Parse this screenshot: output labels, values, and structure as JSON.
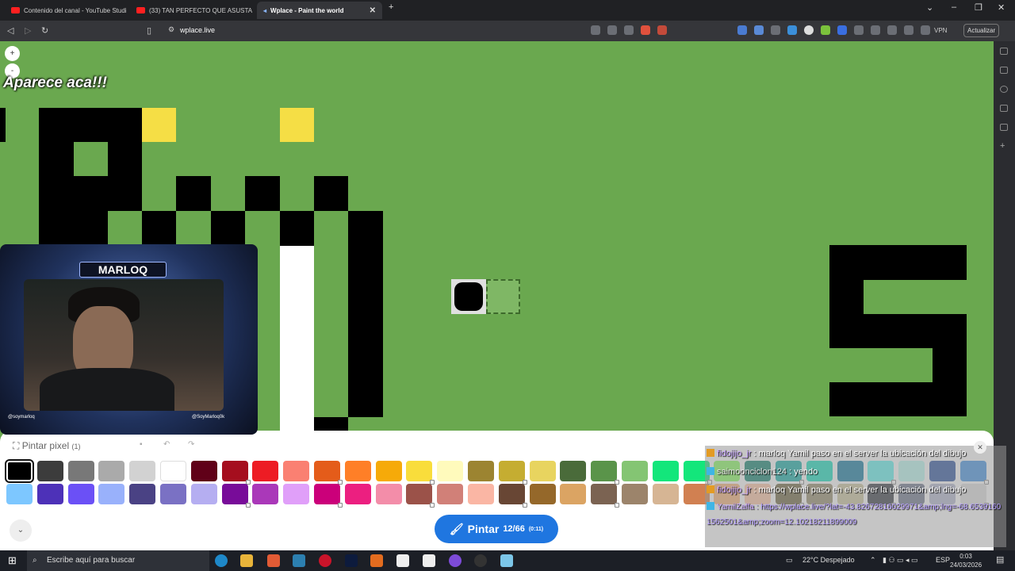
{
  "browser": {
    "tabs": [
      {
        "label": "Contenido del canal - YouTube Studi"
      },
      {
        "label": "(33) TAN PERFECTO QUE ASUSTA"
      },
      {
        "label": "Wplace - Paint the world"
      }
    ],
    "url": "wplace.live",
    "vpn": "VPN",
    "update_label": "Actualizar"
  },
  "canvas": {
    "overlay_text": "Aparece aca!!!",
    "zoom_in": "+",
    "zoom_out": "-"
  },
  "webcam": {
    "name": "MARLOQ",
    "instagram": "@soymarloq",
    "twitter": "@SoyMarloq0k"
  },
  "panel": {
    "title": "Pintar pixel",
    "count": "(1)",
    "paint_label": "Pintar",
    "charges": "12/66",
    "timer": "(0:11)"
  },
  "palette": {
    "row1": [
      "#000000",
      "#3c3c3c",
      "#787878",
      "#aaaaaa",
      "#d2d2d2",
      "#ffffff",
      "#600018",
      "#a50e1e",
      "#ed1c24",
      "#fa8072",
      "#e45c1a",
      "#ff7f27",
      "#f6aa09",
      "#f9dd3b",
      "#fffabc",
      "#9c8431",
      "#c5ad31",
      "#e8d45f",
      "#4a6b3a",
      "#5a944a",
      "#84c573",
      "#13e67b",
      "#13e67b",
      "#87ff5e",
      "#0c816e",
      "#10aea6",
      "#13e1be",
      "#0f799f",
      "#60f7f2",
      "#bbfaf2",
      "#28509e",
      "#4093e4"
    ],
    "row2": [
      "#7dc7ff",
      "#4d31b8",
      "#6b50f6",
      "#99b1fb",
      "#4a4284",
      "#7a71c4",
      "#b5aef1",
      "#780c99",
      "#aa38b9",
      "#e09ff9",
      "#cb007a",
      "#ec1f80",
      "#f38da9",
      "#9b5249",
      "#d18078",
      "#fab6a4",
      "#684634",
      "#95682a",
      "#dba463",
      "#7b6352",
      "#9c846b",
      "#d6b594",
      "#d18051",
      "#f8b277",
      "#ffc5a5",
      "#6d643f",
      "#948c6b",
      "#cdc59e",
      "#333941",
      "#6d758d",
      "#b3b9d1",
      "#e0e0e0"
    ]
  },
  "chat": {
    "messages": [
      {
        "user": "fidojijo_jr",
        "text": " : marloq Yamil paso en el server la ubicación del dibujo"
      },
      {
        "user": "saimoonciclon124",
        "text": " : yendo"
      },
      {
        "user": "fidojijo_jr",
        "text": " : marloq Yamil paso en el server la ubicación del dibujo"
      },
      {
        "user": "YamilZaffa",
        "text": " : https://wplace.live/?lat=-43.82672816029971&amp;lng=-68.65391601562501&amp;zoom=12.10218211899009"
      }
    ]
  },
  "taskbar": {
    "search_placeholder": "Escribe aquí para buscar",
    "weather": "22°C  Despejado",
    "lang": "ESP",
    "time": "0:03",
    "date": "24/03/2026"
  },
  "colors": {
    "canvas_bg": "#6aa84f",
    "paint_button": "#1f76e0"
  }
}
